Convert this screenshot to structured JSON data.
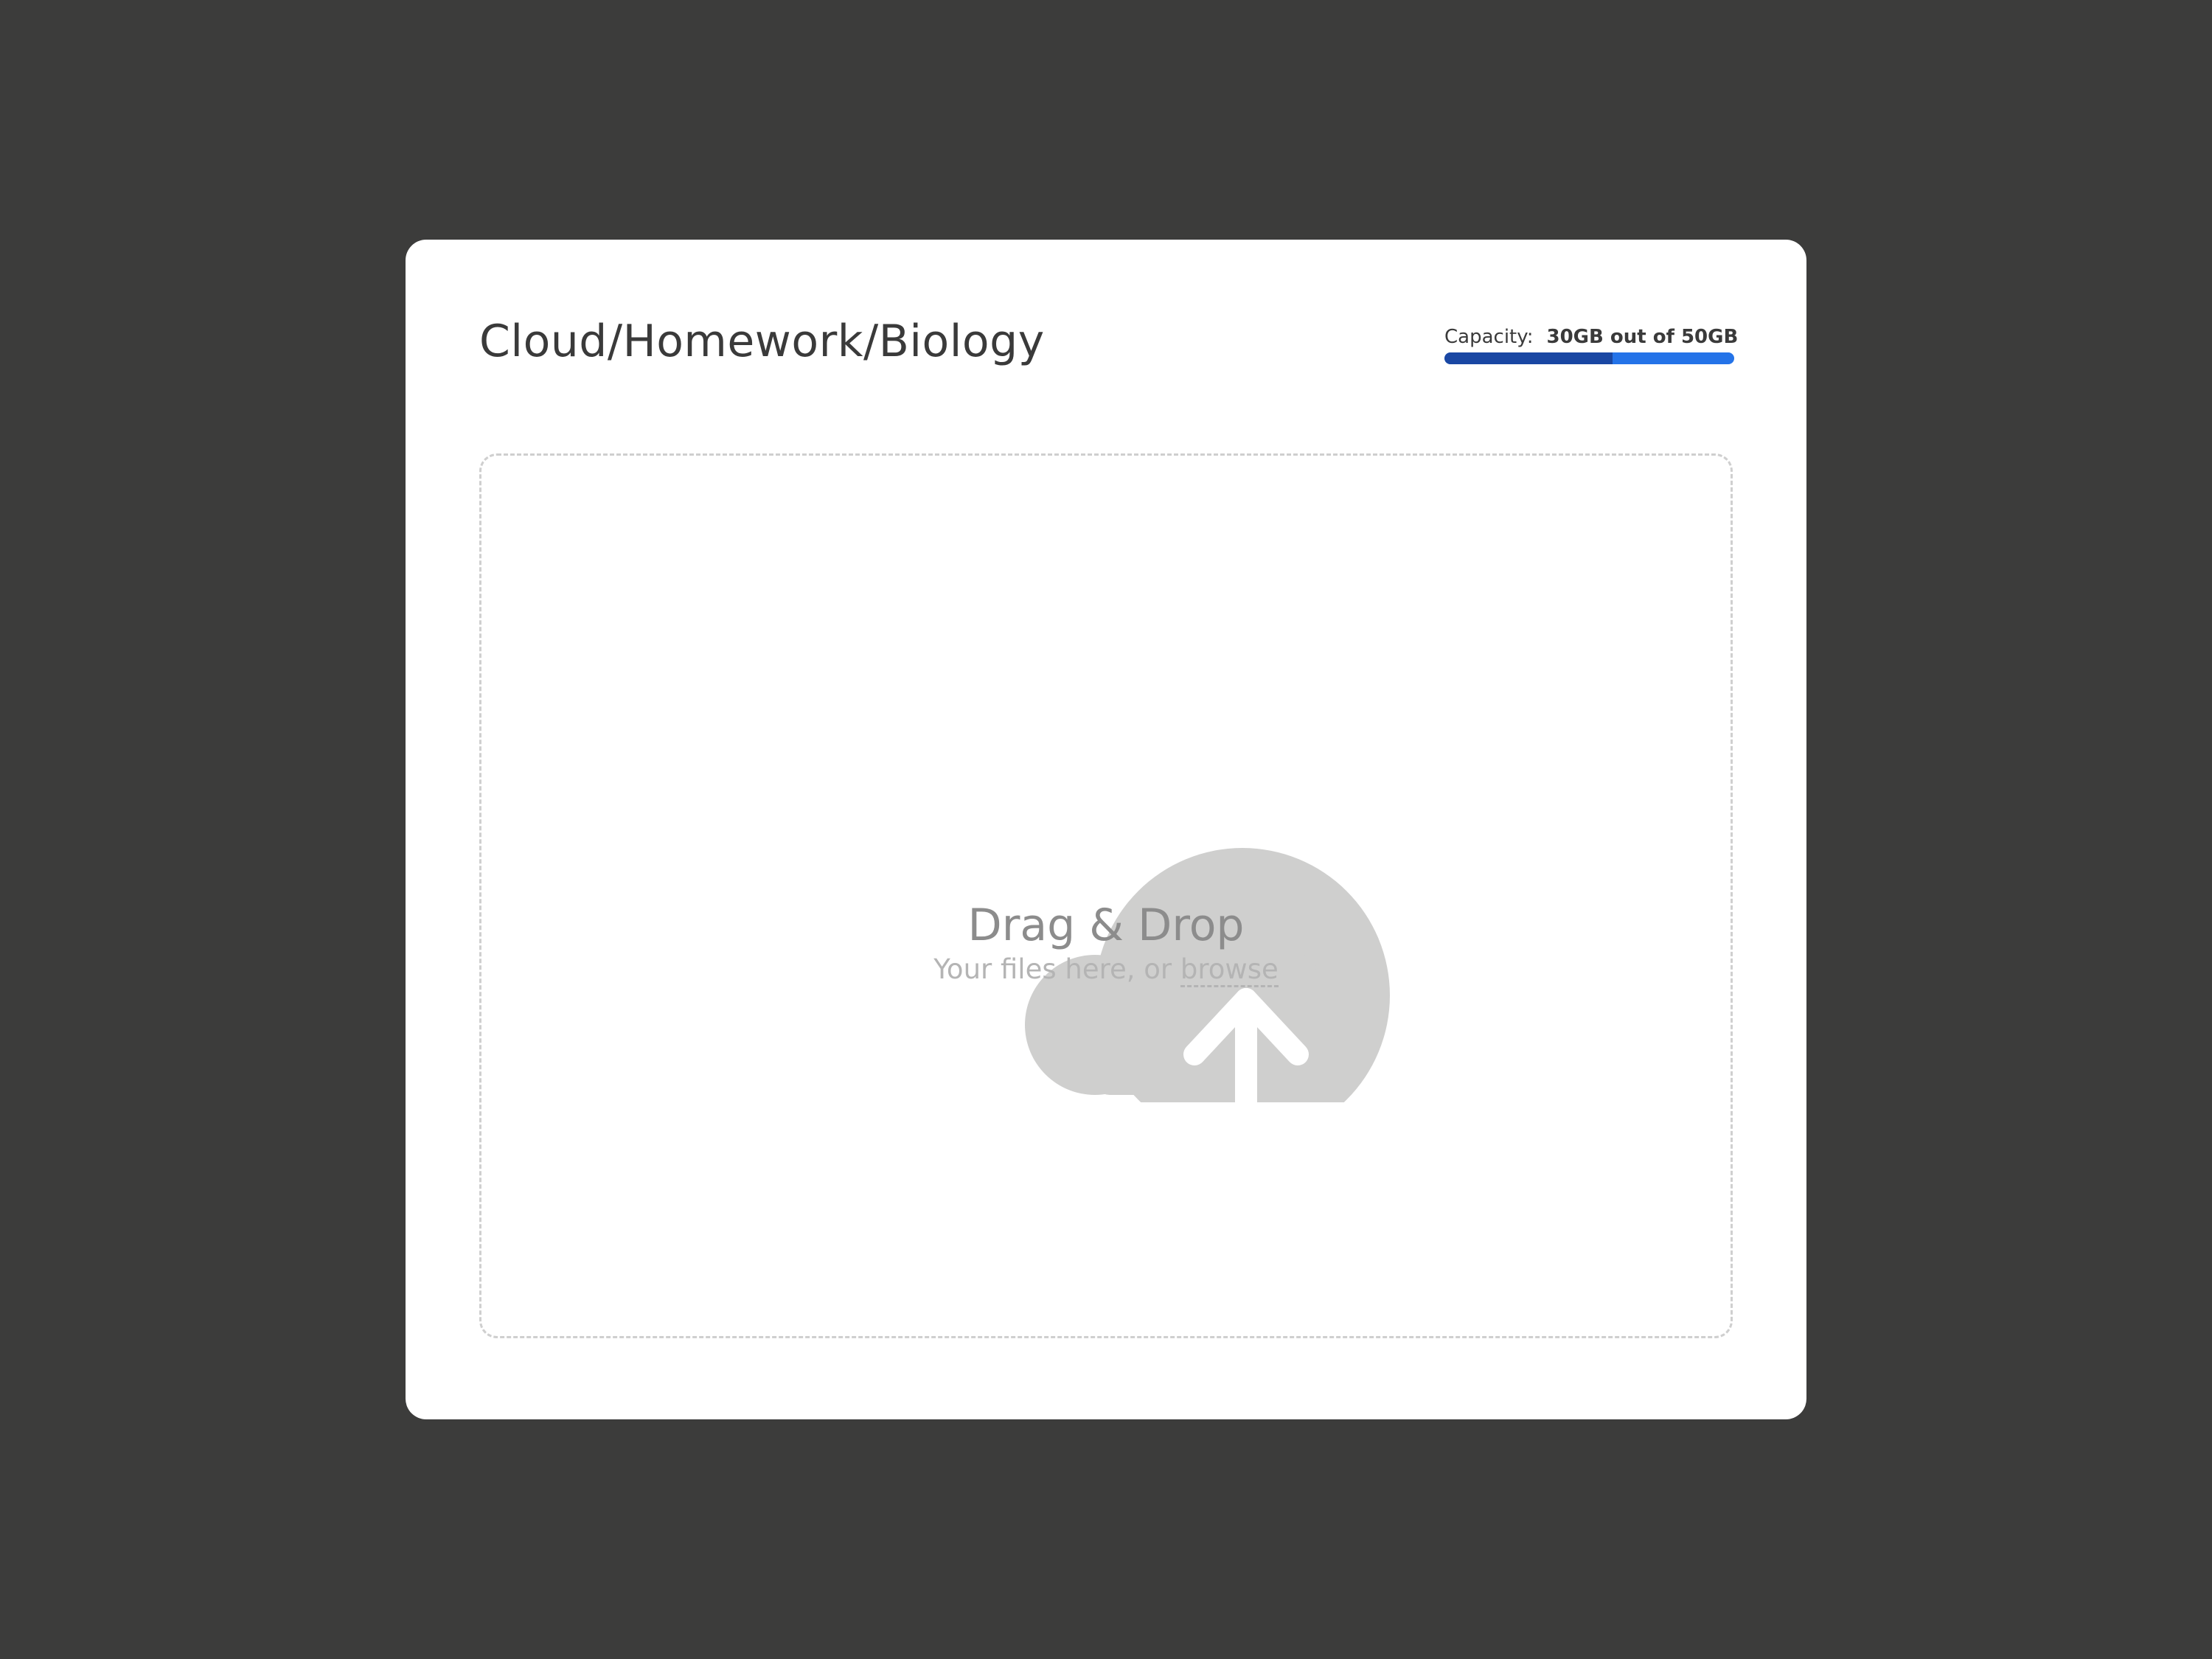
{
  "header": {
    "path": "Cloud/Homework/Biology",
    "capacity": {
      "label": "Capacity:",
      "value": "30GB out of 50GB",
      "used_fraction": 0.58
    }
  },
  "dropzone": {
    "icon": "cloud-upload-icon",
    "heading": "Drag & Drop",
    "subtext": "Your files here, or",
    "browse_label": "browse"
  },
  "colors": {
    "background": "#3c3c3b",
    "card": "#ffffff",
    "capacity_used": "#1a47a3",
    "capacity_total": "#2473e8",
    "icon": "#cfcfce"
  }
}
